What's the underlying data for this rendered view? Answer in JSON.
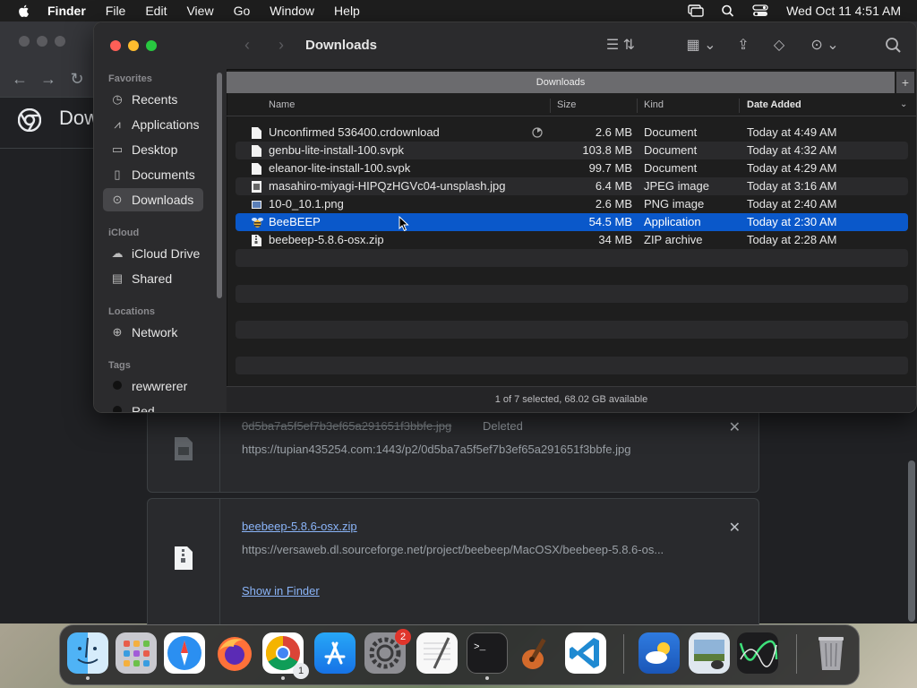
{
  "menubar": {
    "app_name": "Finder",
    "items": [
      "File",
      "Edit",
      "View",
      "Go",
      "Window",
      "Help"
    ],
    "clock": "Wed Oct 11  4:51 AM",
    "status_icons": [
      "screen-mirroring-icon",
      "search-icon",
      "control-center-icon"
    ]
  },
  "chrome": {
    "page_title": "Dow",
    "downloads": [
      {
        "name": "0d5ba7a5f5ef7b3ef65a291651f3bbfe.jpg",
        "status": "Deleted",
        "url": "https://tupian435254.com:1443/p2/0d5ba7a5f5ef7b3ef65a291651f3bbfe.jpg"
      },
      {
        "name": "beebeep-5.8.6-osx.zip",
        "url": "https://versaweb.dl.sourceforge.net/project/beebeep/MacOSX/beebeep-5.8.6-os...",
        "action": "Show in Finder"
      }
    ],
    "close_glyph": "✕"
  },
  "finder": {
    "title": "Downloads",
    "path_bar": "Downloads",
    "sidebar": {
      "favorites_label": "Favorites",
      "favorites": [
        {
          "label": "Recents",
          "icon": "clock-icon"
        },
        {
          "label": "Applications",
          "icon": "applications-icon"
        },
        {
          "label": "Desktop",
          "icon": "desktop-icon"
        },
        {
          "label": "Documents",
          "icon": "document-icon"
        },
        {
          "label": "Downloads",
          "icon": "download-icon",
          "selected": true
        }
      ],
      "icloud_label": "iCloud",
      "icloud": [
        {
          "label": "iCloud Drive",
          "icon": "cloud-icon"
        },
        {
          "label": "Shared",
          "icon": "shared-folder-icon"
        }
      ],
      "locations_label": "Locations",
      "locations": [
        {
          "label": "Network",
          "icon": "network-icon"
        }
      ],
      "tags_label": "Tags",
      "tags": [
        {
          "label": "rewwrerer",
          "color": "#111111"
        },
        {
          "label": "Red",
          "color": "#111111"
        }
      ]
    },
    "columns": {
      "name": "Name",
      "size": "Size",
      "kind": "Kind",
      "date": "Date Added"
    },
    "files": [
      {
        "name": "Unconfirmed 536400.crdownload",
        "size": "2.6 MB",
        "kind": "Document",
        "date": "Today at 4:49 AM",
        "icon": "document-icon",
        "downloading": true
      },
      {
        "name": "genbu-lite-install-100.svpk",
        "size": "103.8 MB",
        "kind": "Document",
        "date": "Today at 4:32 AM",
        "icon": "document-icon"
      },
      {
        "name": "eleanor-lite-install-100.svpk",
        "size": "99.7 MB",
        "kind": "Document",
        "date": "Today at 4:29 AM",
        "icon": "document-icon"
      },
      {
        "name": "masahiro-miyagi-HIPQzHGVc04-unsplash.jpg",
        "size": "6.4 MB",
        "kind": "JPEG image",
        "date": "Today at 3:16 AM",
        "icon": "jpeg-icon"
      },
      {
        "name": "10-0_10.1.png",
        "size": "2.6 MB",
        "kind": "PNG image",
        "date": "Today at 2:40 AM",
        "icon": "png-icon"
      },
      {
        "name": "BeeBEEP",
        "size": "54.5 MB",
        "kind": "Application",
        "date": "Today at 2:30 AM",
        "icon": "beebeep-app-icon",
        "selected": true
      },
      {
        "name": "beebeep-5.8.6-osx.zip",
        "size": "34 MB",
        "kind": "ZIP archive",
        "date": "Today at 2:28 AM",
        "icon": "zip-icon"
      }
    ],
    "status": "1 of 7 selected, 68.02 GB available"
  },
  "dock": {
    "apps": [
      "finder",
      "launchpad",
      "safari",
      "firefox",
      "chrome",
      "app-store",
      "system-settings",
      "textedit",
      "terminal",
      "garageband",
      "vscode",
      "weather",
      "preview",
      "activity-monitor",
      "trash"
    ],
    "chrome_badge": "1",
    "settings_badge": "2"
  }
}
